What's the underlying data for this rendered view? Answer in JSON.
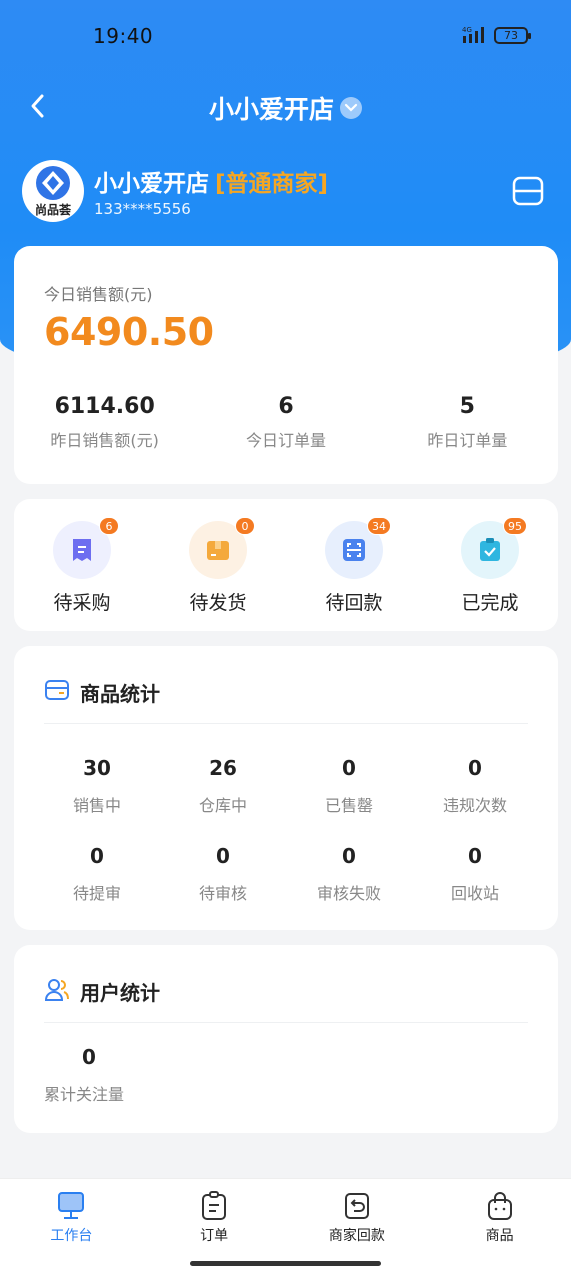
{
  "status_bar": {
    "time": "19:40",
    "battery": "73"
  },
  "nav": {
    "title": "小小爱开店"
  },
  "shop": {
    "logo_text": "尚品荟",
    "name": "小小爱开店",
    "tag": "[普通商家]",
    "phone": "133****5556"
  },
  "sales": {
    "label": "今日销售额(元)",
    "value": "6490.50",
    "stats": [
      {
        "value": "6114.60",
        "label": "昨日销售额(元)"
      },
      {
        "value": "6",
        "label": "今日订单量"
      },
      {
        "value": "5",
        "label": "昨日订单量"
      }
    ]
  },
  "orders": [
    {
      "label": "待采购",
      "badge": "6",
      "icon": "receipt-icon",
      "bg": "#eef0fe",
      "color": "#6d6ef0"
    },
    {
      "label": "待发货",
      "badge": "0",
      "icon": "box-icon",
      "bg": "#fdf1e3",
      "color": "#f4a93c"
    },
    {
      "label": "待回款",
      "badge": "34",
      "icon": "scan-icon",
      "bg": "#e7effd",
      "color": "#4a82ee"
    },
    {
      "label": "已完成",
      "badge": "95",
      "icon": "clipboard-check-icon",
      "bg": "#e3f5fb",
      "color": "#2fb6e0"
    }
  ],
  "goods": {
    "title": "商品统计",
    "row1": [
      {
        "value": "30",
        "label": "销售中"
      },
      {
        "value": "26",
        "label": "仓库中"
      },
      {
        "value": "0",
        "label": "已售罄"
      },
      {
        "value": "0",
        "label": "违规次数"
      }
    ],
    "row2": [
      {
        "value": "0",
        "label": "待提审"
      },
      {
        "value": "0",
        "label": "待审核"
      },
      {
        "value": "0",
        "label": "审核失败"
      },
      {
        "value": "0",
        "label": "回收站"
      }
    ]
  },
  "users": {
    "title": "用户统计",
    "value": "0",
    "label": "累计关注量"
  },
  "tabs": [
    {
      "label": "工作台",
      "icon": "monitor-icon",
      "active": true
    },
    {
      "label": "订单",
      "icon": "order-icon",
      "active": false
    },
    {
      "label": "商家回款",
      "icon": "refund-icon",
      "active": false
    },
    {
      "label": "商品",
      "icon": "bag-icon",
      "active": false
    }
  ],
  "colors": {
    "primary": "#1f8cf6",
    "accent": "#f28a1e",
    "badge": "#f47a22"
  }
}
